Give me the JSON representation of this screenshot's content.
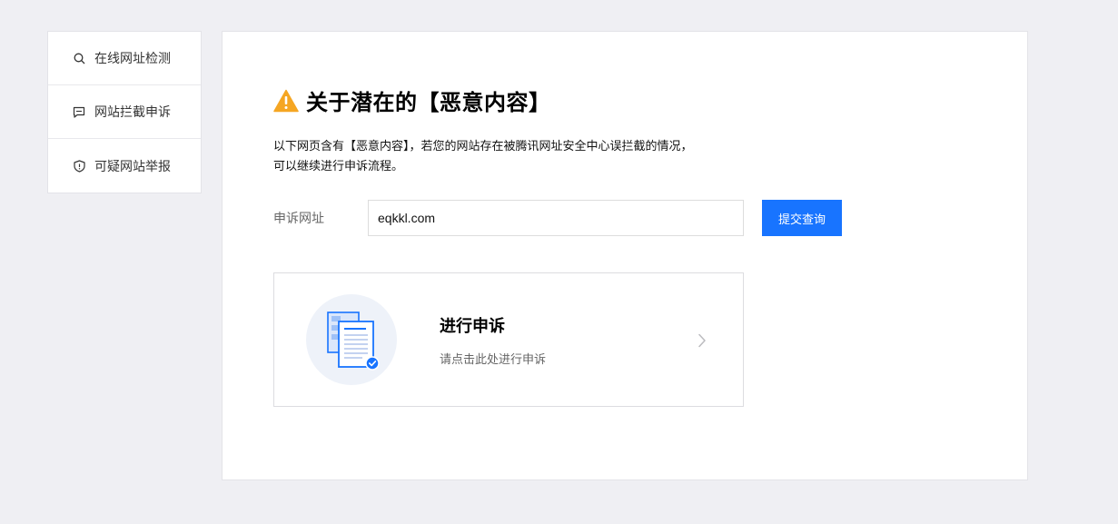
{
  "sidebar": {
    "items": [
      {
        "label": "在线网址检测",
        "icon": "search-icon"
      },
      {
        "label": "网站拦截申诉",
        "icon": "comment-icon"
      },
      {
        "label": "可疑网站举报",
        "icon": "shield-icon"
      }
    ]
  },
  "main": {
    "title": "关于潜在的【恶意内容】",
    "description_line1": "以下网页含有【恶意内容】，若您的网站存在被腾讯网址安全中心误拦截的情况，",
    "description_line2": "可以继续进行申诉流程。",
    "form": {
      "label": "申诉网址",
      "value": "eqkkl.com",
      "submit_label": "提交查询"
    },
    "appeal_card": {
      "title": "进行申诉",
      "subtitle": "请点击此处进行申诉"
    }
  },
  "colors": {
    "accent": "#1874ff",
    "warning": "#f5a623",
    "background": "#efeff3"
  }
}
